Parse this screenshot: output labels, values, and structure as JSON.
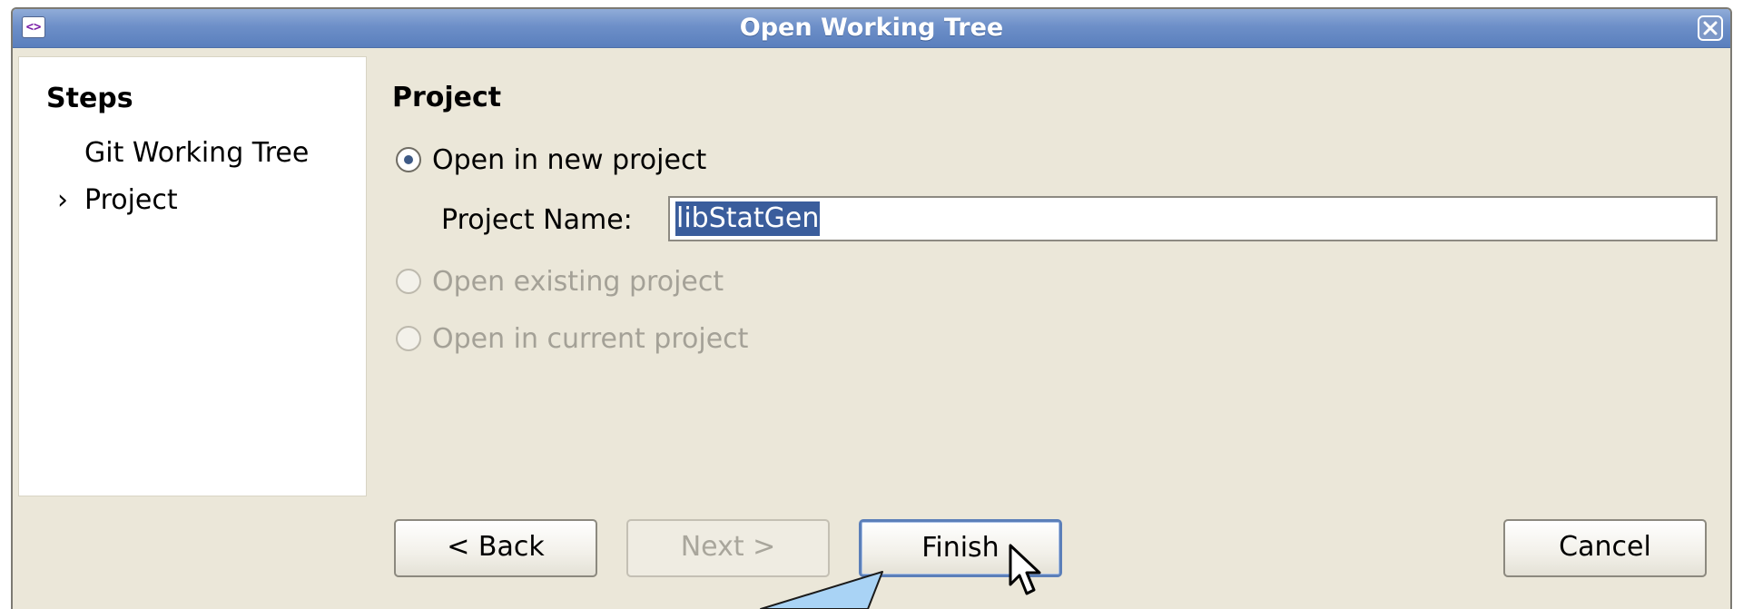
{
  "window": {
    "title": "Open Working Tree",
    "app_icon_glyph": "<>"
  },
  "steps": {
    "heading": "Steps",
    "items": [
      {
        "label": "Git Working Tree",
        "marker": ""
      },
      {
        "label": "Project",
        "marker": "›"
      }
    ]
  },
  "project": {
    "heading": "Project",
    "options": [
      {
        "label": "Open in new project",
        "selected": true,
        "enabled": true
      },
      {
        "label": "Open existing project",
        "selected": false,
        "enabled": false
      },
      {
        "label": "Open in current project",
        "selected": false,
        "enabled": false
      }
    ],
    "name_label": "Project Name:",
    "name_value": "libStatGen"
  },
  "buttons": {
    "back": "< Back",
    "next": "Next >",
    "finish": "Finish",
    "cancel": "Cancel"
  },
  "colors": {
    "accent": "#5a7fbd",
    "selection": "#3a5d9c",
    "callout": "#a9d3f5"
  },
  "icons": [
    "app-icon",
    "close-icon",
    "radio-selected-icon",
    "mouse-pointer-icon"
  ]
}
